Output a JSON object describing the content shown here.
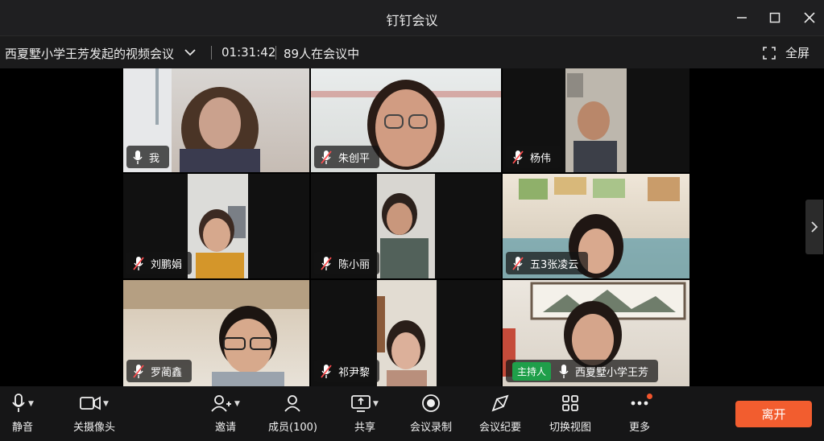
{
  "window": {
    "title": "钉钉会议"
  },
  "info": {
    "meeting_name": "西夏墅小学王芳发起的视频会议",
    "timer": "01:31:42",
    "participants_text": "89人在会议中",
    "fullscreen_label": "全屏"
  },
  "participants": [
    {
      "name": "我",
      "muted": false,
      "host": false
    },
    {
      "name": "朱创平",
      "muted": true,
      "host": false
    },
    {
      "name": "杨伟",
      "muted": true,
      "host": false
    },
    {
      "name": "刘鹏娟",
      "muted": true,
      "host": false
    },
    {
      "name": "陈小丽",
      "muted": true,
      "host": false
    },
    {
      "name": "五3张凌云",
      "muted": true,
      "host": false
    },
    {
      "name": "罗蔺鑫",
      "muted": true,
      "host": false
    },
    {
      "name": "祁尹黎",
      "muted": true,
      "host": false
    },
    {
      "name": "西夏墅小学王芳",
      "muted": false,
      "host": true,
      "host_label": "主持人"
    }
  ],
  "toolbar": {
    "mute_label": "静音",
    "camera_label": "关摄像头",
    "invite_label": "邀请",
    "members_label": "成员(100)",
    "share_label": "共享",
    "record_label": "会议录制",
    "minutes_label": "会议纪要",
    "view_label": "切换视图",
    "more_label": "更多",
    "leave_label": "离开"
  },
  "colors": {
    "leave": "#f25d2f",
    "host_badge": "#1f9f4a",
    "notification": "#f2552c"
  }
}
